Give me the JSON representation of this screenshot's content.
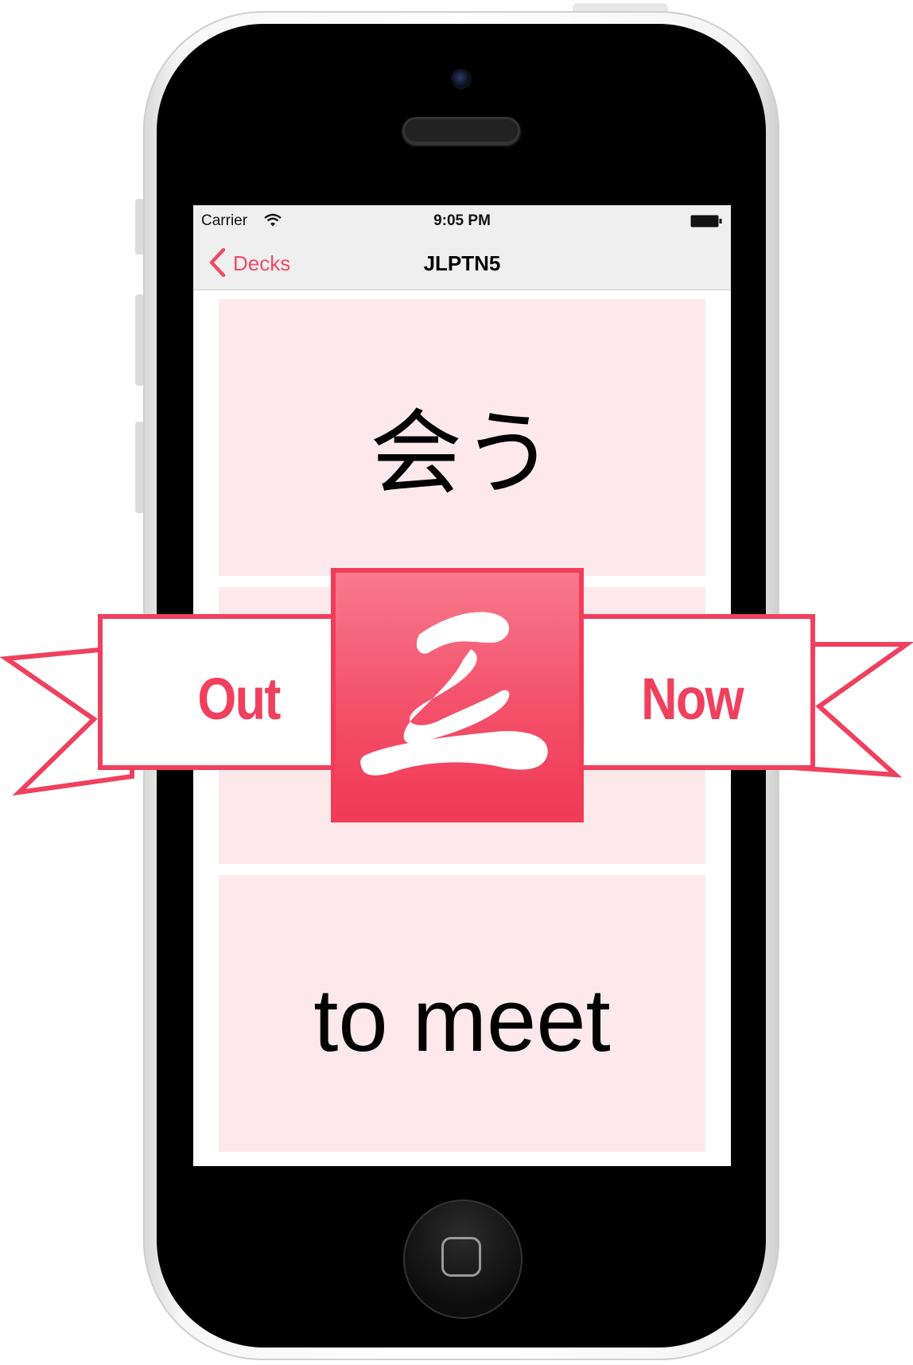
{
  "status_bar": {
    "carrier": "Carrier",
    "time": "9:05 PM"
  },
  "nav": {
    "back_label": "Decks",
    "title": "JLPTN5"
  },
  "cards": {
    "word": "会う",
    "meaning": "to meet"
  },
  "banner": {
    "left": "Out",
    "right": "Now"
  },
  "colors": {
    "accent": "#f0405e",
    "card_bg": "#fde9ec",
    "nav_bg": "#efefef"
  },
  "icons": [
    "wifi-icon",
    "battery-icon",
    "chevron-left-icon",
    "app-logo-icon"
  ]
}
